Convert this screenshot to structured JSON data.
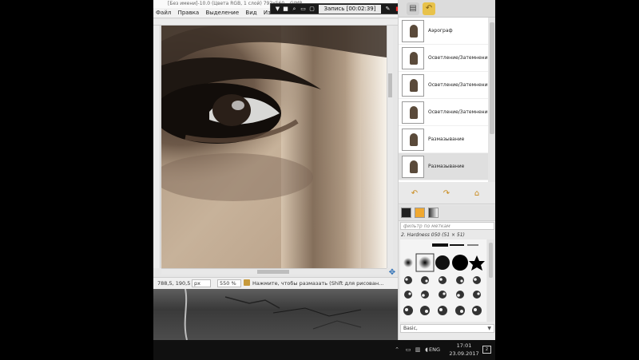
{
  "window": {
    "title": "[Без имени]-10.0 (Цвета RGB, 1 слой) 792x560 – GIMP"
  },
  "menu": {
    "items": [
      "Файл",
      "Правка",
      "Выделение",
      "Вид",
      "Изоб"
    ]
  },
  "recorder": {
    "timer": "Запись [00:02:39]",
    "record_color": "#ff2a2a"
  },
  "statusbar": {
    "coords": "788,5, 190,5",
    "unit": "px",
    "zoom": "550 %",
    "hint": "Нажмите, чтобы размазать (Shift для рисован..."
  },
  "history": {
    "items": [
      {
        "label": "Аэрограф",
        "selected": false
      },
      {
        "label": "Осветление/Затемнение",
        "selected": false
      },
      {
        "label": "Осветление/Затемнение",
        "selected": false
      },
      {
        "label": "Осветление/Затемнение",
        "selected": false
      },
      {
        "label": "Размазывание",
        "selected": false
      },
      {
        "label": "Размазывание",
        "selected": true
      }
    ]
  },
  "brushes": {
    "filter_placeholder": "фильтр по меткам",
    "current": "2. Hardness 050 (51 × 51)",
    "tag_label": "Basic,"
  },
  "taskbar": {
    "lang": "ENG",
    "time": "17:01",
    "date": "23.09.2017"
  },
  "colors": {
    "accent": "#c98a1b",
    "selected_row": "#dfdfdf"
  }
}
